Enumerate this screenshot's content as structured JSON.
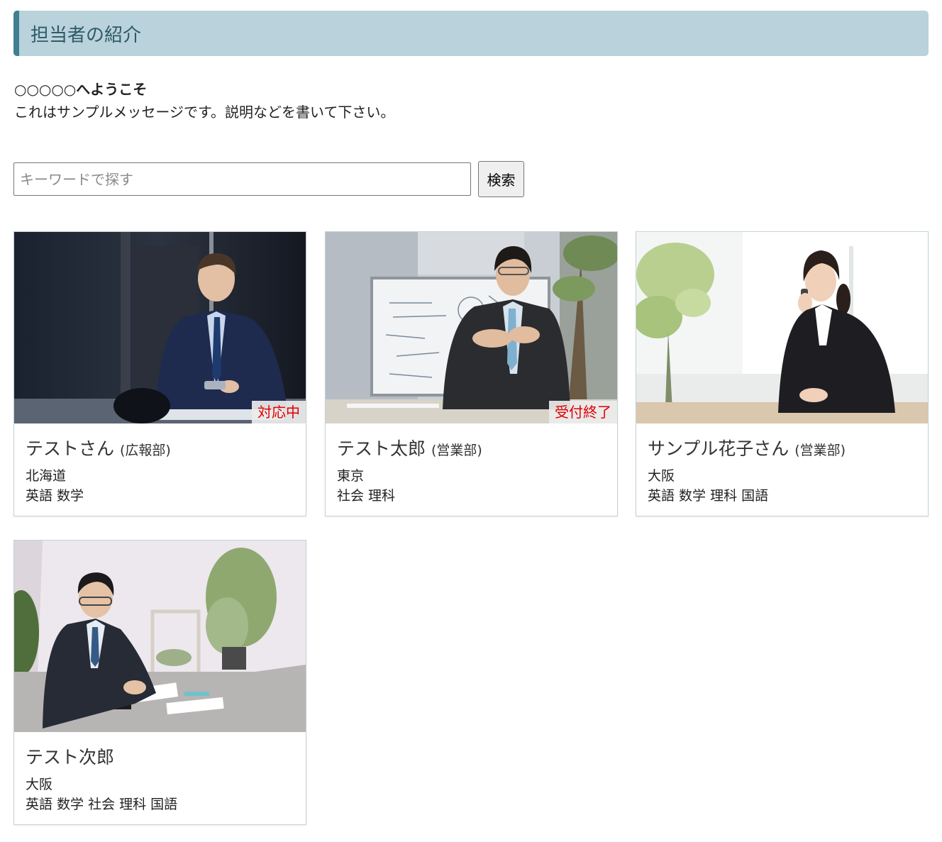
{
  "header": {
    "title": "担当者の紹介"
  },
  "intro": {
    "welcome": "○○○○○へようこそ",
    "message": "これはサンプルメッセージです。説明などを書いて下さい。"
  },
  "search": {
    "placeholder": "キーワードで探す",
    "value": "",
    "button_label": "検索"
  },
  "cards": [
    {
      "name": "テストさん",
      "dept": "(広報部)",
      "region": "北海道",
      "subjects": "英語 数学",
      "badge": "対応中"
    },
    {
      "name": "テスト太郎",
      "dept": "(営業部)",
      "region": "東京",
      "subjects": "社会 理科",
      "badge": "受付終了"
    },
    {
      "name": "サンプル花子さん",
      "dept": "(営業部)",
      "region": "大阪",
      "subjects": "英語 数学 理科 国語",
      "badge": ""
    },
    {
      "name": "テスト次郎",
      "dept": "",
      "region": "大阪",
      "subjects": "英語 数学 社会 理科 国語",
      "badge": ""
    }
  ],
  "colors": {
    "heading_bg": "#b9d2db",
    "heading_accent": "#3f7f8f",
    "badge_text": "#e00000"
  }
}
